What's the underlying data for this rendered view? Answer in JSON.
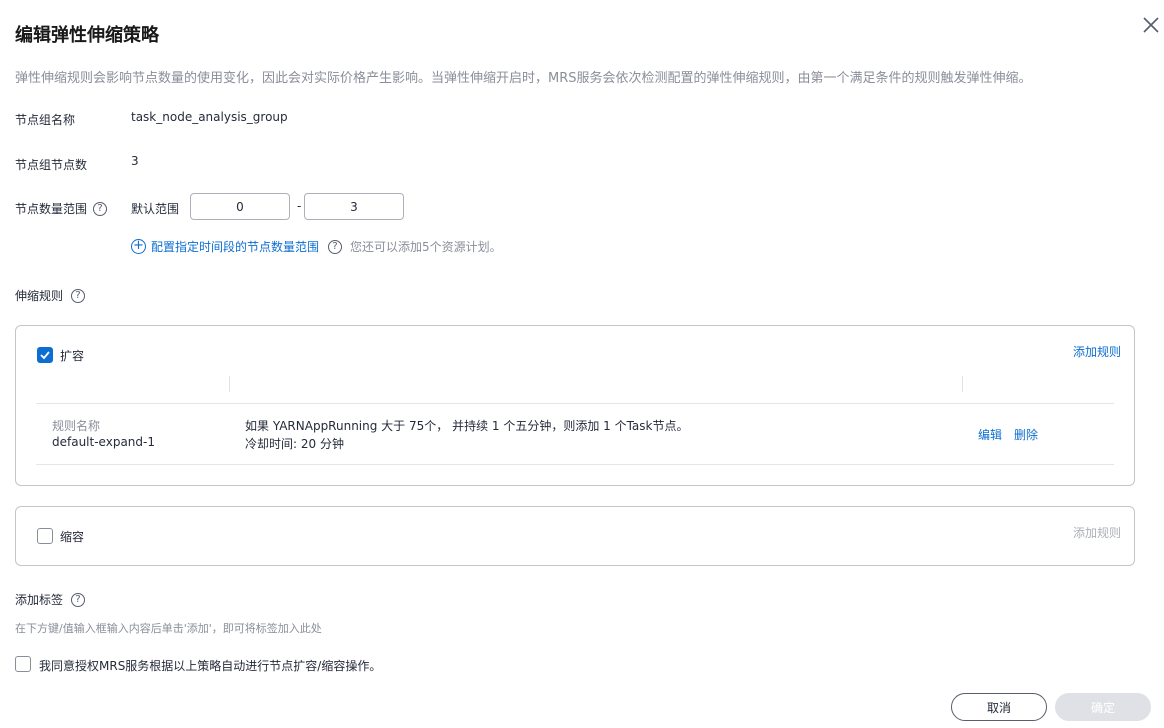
{
  "dialog": {
    "title": "编辑弹性伸缩策略",
    "description": "弹性伸缩规则会影响节点数量的使用变化，因此会对实际价格产生影响。当弹性伸缩开启时，MRS服务会依次检测配置的弹性伸缩规则，由第一个满足条件的规则触发弹性伸缩。"
  },
  "node_group": {
    "name_label": "节点组名称",
    "name_value": "task_node_analysis_group",
    "count_label": "节点组节点数",
    "count_value": "3",
    "range_label": "节点数量范围",
    "default_range_label": "默认范围",
    "range_min": "0",
    "range_separator": "-",
    "range_max": "3",
    "add_range_link": "配置指定时间段的节点数量范围",
    "add_range_hint": "您还可以添加5个资源计划。"
  },
  "scaling_rules": {
    "label": "伸缩规则",
    "expand": {
      "title": "扩容",
      "checked": true,
      "add_rule": "添加规则",
      "rules": [
        {
          "name_label": "规则名称",
          "name": "default-expand-1",
          "condition": "如果 YARNAppRunning 大于 75个， 并持续 1 个五分钟，则添加 1 个Task节点。",
          "cooldown": "冷却时间: 20 分钟",
          "edit": "编辑",
          "delete": "删除"
        }
      ]
    },
    "shrink": {
      "title": "缩容",
      "checked": false,
      "add_rule": "添加规则"
    }
  },
  "tags": {
    "label": "添加标签",
    "hint": "在下方键/值输入框输入内容后单击'添加'，即可将标签加入此处"
  },
  "agreement": {
    "text": "我同意授权MRS服务根据以上策略自动进行节点扩容/缩容操作。",
    "checked": false
  },
  "buttons": {
    "cancel": "取消",
    "ok": "确定"
  },
  "colors": {
    "accent": "#0d6ed1",
    "muted": "#8a8e99",
    "border": "#c2c5cc"
  }
}
